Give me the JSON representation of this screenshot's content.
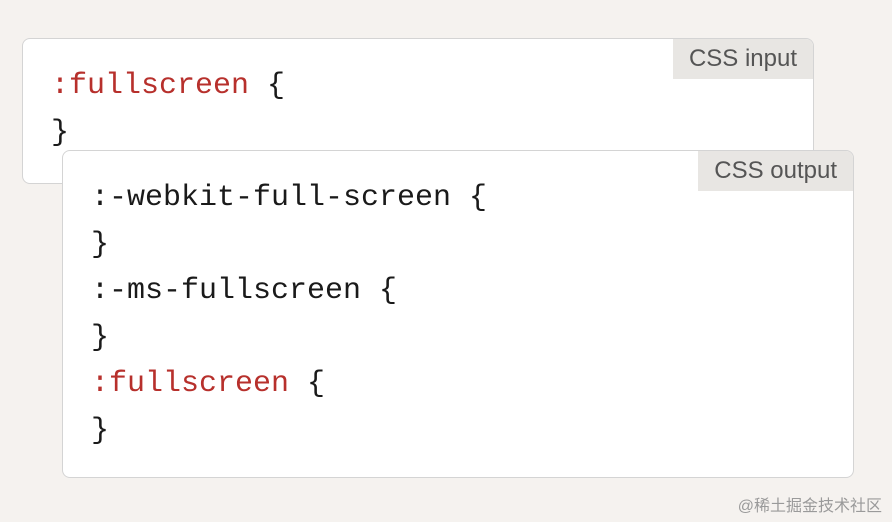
{
  "input_box": {
    "label": "CSS input",
    "code": [
      {
        "cls": "selector",
        "text": ":fullscreen"
      },
      {
        "cls": "plain",
        "text": " {\n}"
      }
    ]
  },
  "output_box": {
    "label": "CSS output",
    "code": [
      {
        "cls": "plain",
        "text": ":-webkit-full-screen {\n}\n:-ms-fullscreen {\n}\n"
      },
      {
        "cls": "selector",
        "text": ":fullscreen"
      },
      {
        "cls": "plain",
        "text": " {\n}"
      }
    ]
  },
  "watermark": "@稀土掘金技术社区"
}
